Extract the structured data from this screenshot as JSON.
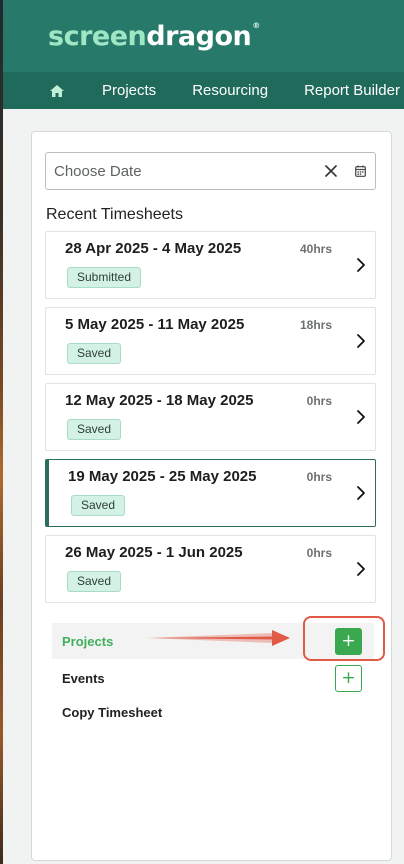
{
  "brand": {
    "logo_part1": "screen",
    "logo_part2": "dragon",
    "logo_tm": "®"
  },
  "nav": {
    "items": [
      {
        "label": "Projects"
      },
      {
        "label": "Resourcing"
      },
      {
        "label": "Report Builder"
      }
    ]
  },
  "date_picker": {
    "placeholder": "Choose Date",
    "value": ""
  },
  "recent": {
    "title": "Recent Timesheets",
    "timesheets": [
      {
        "range": "28 Apr 2025 - 4 May 2025",
        "hours": "40hrs",
        "status": "Submitted"
      },
      {
        "range": "5 May 2025 - 11 May 2025",
        "hours": "18hrs",
        "status": "Saved"
      },
      {
        "range": "12 May 2025 - 18 May 2025",
        "hours": "0hrs",
        "status": "Saved"
      },
      {
        "range": "19 May 2025 - 25 May 2025",
        "hours": "0hrs",
        "status": "Saved"
      },
      {
        "range": "26 May 2025 - 1 Jun 2025",
        "hours": "0hrs",
        "status": "Saved"
      }
    ],
    "active_index": 3
  },
  "options": {
    "projects_label": "Projects",
    "events_label": "Events",
    "copy_label": "Copy Timesheet",
    "add_symbol": "+"
  },
  "colors": {
    "brand_bar": "#277a6a",
    "nav_bar": "#1f6a5b",
    "accent_green": "#3aa84f",
    "callout_red": "#e05a45",
    "badge_bg": "#d3f1e4"
  },
  "icons": {
    "home": "home-icon",
    "clear": "close-icon",
    "calendar": "calendar-icon",
    "chevron": "chevron-right-icon"
  }
}
